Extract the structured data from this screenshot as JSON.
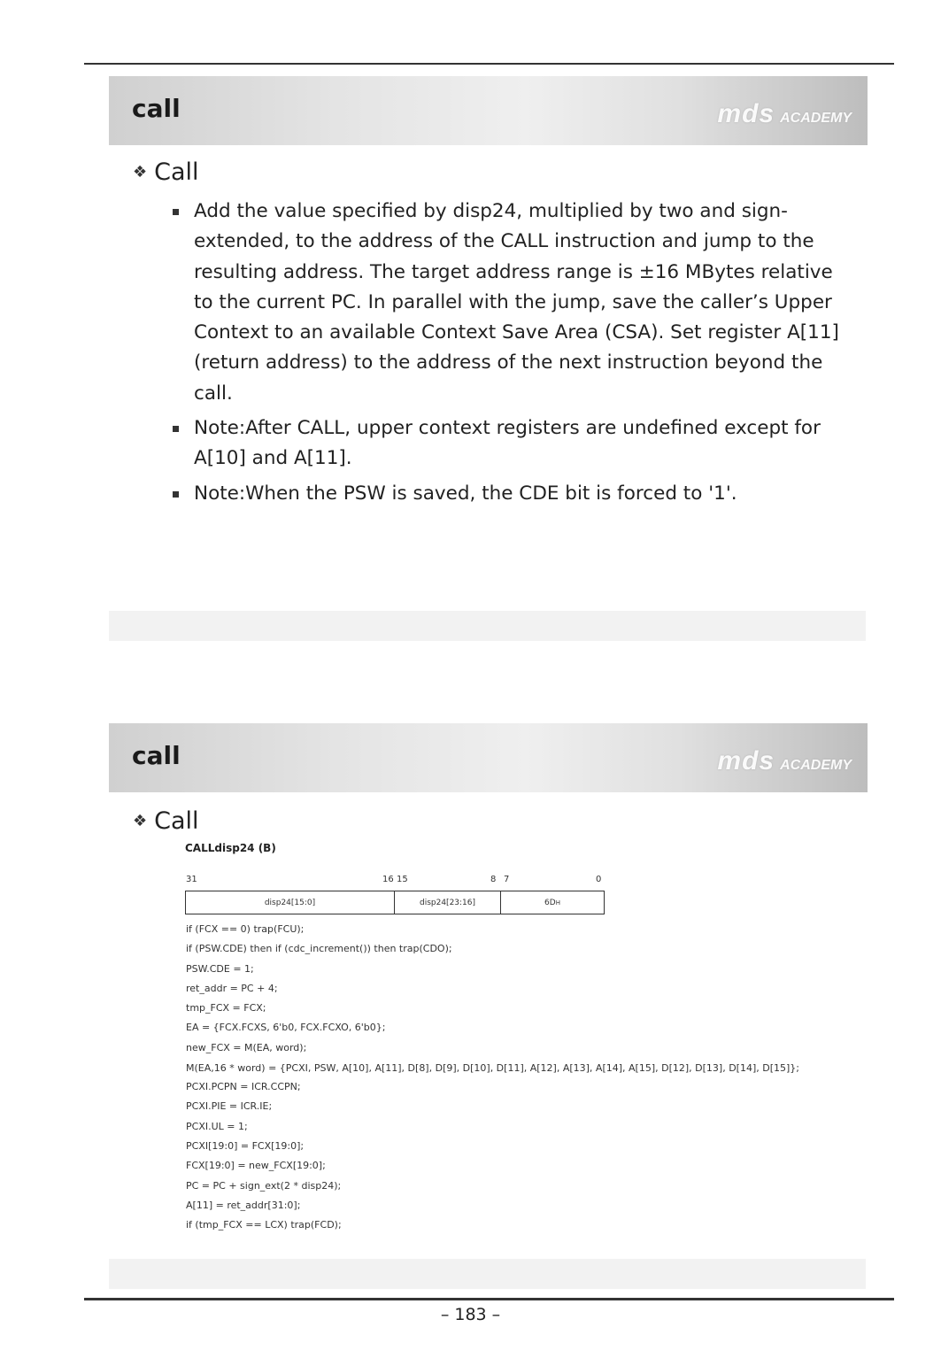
{
  "slide1": {
    "title": "call",
    "logo_main": "mds",
    "logo_sub": "ACADEMY",
    "subheading": "Call",
    "bullets": [
      "Add the value specified by disp24, multiplied by two and sign-extended, to the address of the CALL instruction and jump to the resulting address. The target address range is ±16 MBytes relative to the current PC. In parallel with the jump, save the caller’s Upper Context to an available Context Save Area (CSA). Set register A[11] (return address) to the address of the next instruction beyond the call.",
      "Note:After CALL, upper context registers are undefined except for A[10] and A[11].",
      "Note:When the PSW is saved, the CDE bit is forced to '1'."
    ]
  },
  "slide2": {
    "title": "call",
    "logo_main": "mds",
    "logo_sub": "ACADEMY",
    "subheading": "Call",
    "instruction": "CALLdisp24 (B)",
    "bit_numbers": [
      "31",
      "16",
      "15",
      "8",
      "7",
      "0"
    ],
    "fields": [
      "disp24[15:0]",
      "disp24[23:16]",
      "6D"
    ],
    "field_subscript": "H",
    "code": [
      "if (FCX == 0) trap(FCU);",
      "if (PSW.CDE) then if (cdc_increment()) then trap(CDO);",
      "PSW.CDE = 1;",
      "ret_addr = PC + 4;",
      "tmp_FCX = FCX;",
      "EA = {FCX.FCXS, 6'b0, FCX.FCXO, 6'b0};",
      "new_FCX = M(EA, word);",
      "M(EA,16 * word) = {PCXI, PSW, A[10], A[11], D[8], D[9], D[10], D[11], A[12], A[13], A[14], A[15], D[12], D[13], D[14], D[15]};",
      "PCXI.PCPN = ICR.CCPN;",
      "PCXI.PIE = ICR.IE;",
      "PCXI.UL = 1;",
      "PCXI[19:0] = FCX[19:0];",
      "FCX[19:0] = new_FCX[19:0];",
      "PC = PC + sign_ext(2 * disp24);",
      "A[11] = ret_addr[31:0];",
      "if (tmp_FCX == LCX) trap(FCD);"
    ]
  },
  "page_number": "– 183 –"
}
